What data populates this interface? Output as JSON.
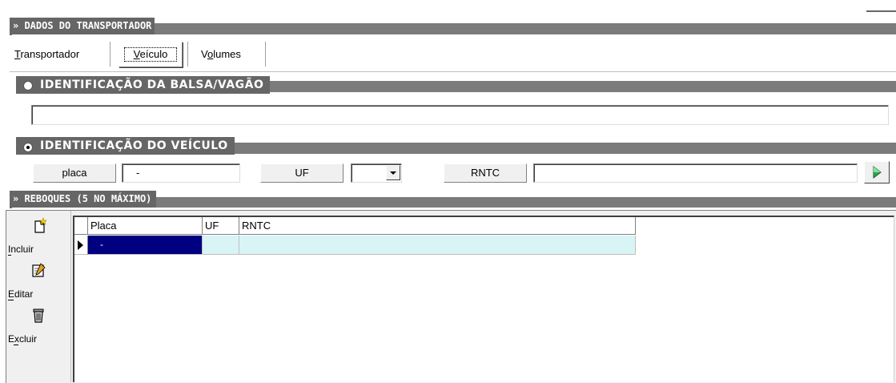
{
  "section_transportador": "» DADOS DO TRANSPORTADOR",
  "tabs": [
    {
      "label": "Transportador"
    },
    {
      "label": "Veículo"
    },
    {
      "label": "Volumes"
    }
  ],
  "section_balsa": "IDENTIFICAÇÃO DA BALSA/VAGÃO",
  "balsa_value": "",
  "section_veiculo": "IDENTIFICAÇÃO DO VEÍCULO",
  "veiculo": {
    "placa_label": "placa",
    "placa_value": "-",
    "uf_label": "UF",
    "uf_value": "",
    "rntc_label": "RNTC",
    "rntc_value": ""
  },
  "section_reboques": "» REBOQUES (5 NO MÁXIMO)",
  "toolbar": {
    "incluir": "Incluir",
    "editar": "Editar",
    "excluir": "Excluir"
  },
  "grid": {
    "columns": [
      "Placa",
      "UF",
      "RNTC"
    ],
    "rows": [
      {
        "placa": "-",
        "uf": "",
        "rntc": ""
      }
    ]
  },
  "colors": {
    "section_bar": "#7b7b7b",
    "grid_selected": "#000080",
    "grid_row": "#d8f4f4"
  }
}
